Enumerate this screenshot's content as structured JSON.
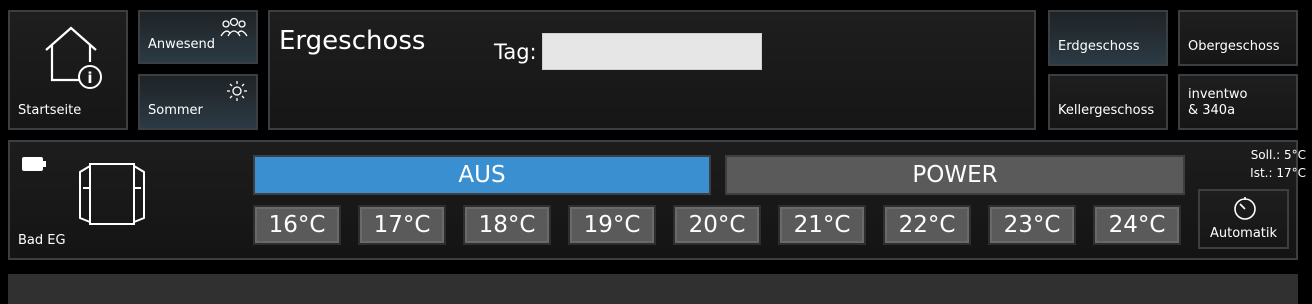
{
  "nav": {
    "home_label": "Startseite",
    "presence_label": "Anwesend",
    "season_label": "Sommer",
    "floor_title": "Ergeschoss",
    "day_label": "Tag:",
    "day_value": "",
    "floors": [
      "Erdgeschoss",
      "Obergeschoss",
      "Kellergeschoss"
    ],
    "extra_line1": "inventwo",
    "extra_line2": "& 340a"
  },
  "room": {
    "name": "Bad EG",
    "off_label": "AUS",
    "power_label": "POWER",
    "temps": [
      "16°C",
      "17°C",
      "18°C",
      "19°C",
      "20°C",
      "21°C",
      "22°C",
      "23°C",
      "24°C"
    ],
    "setpoint": "Soll.: 5°C",
    "actual": "Ist.: 17°C",
    "auto_label": "Automatik"
  },
  "colors": {
    "active": "#3a8fd0",
    "inactive": "#5a5a5a",
    "border": "#3a3f44"
  }
}
